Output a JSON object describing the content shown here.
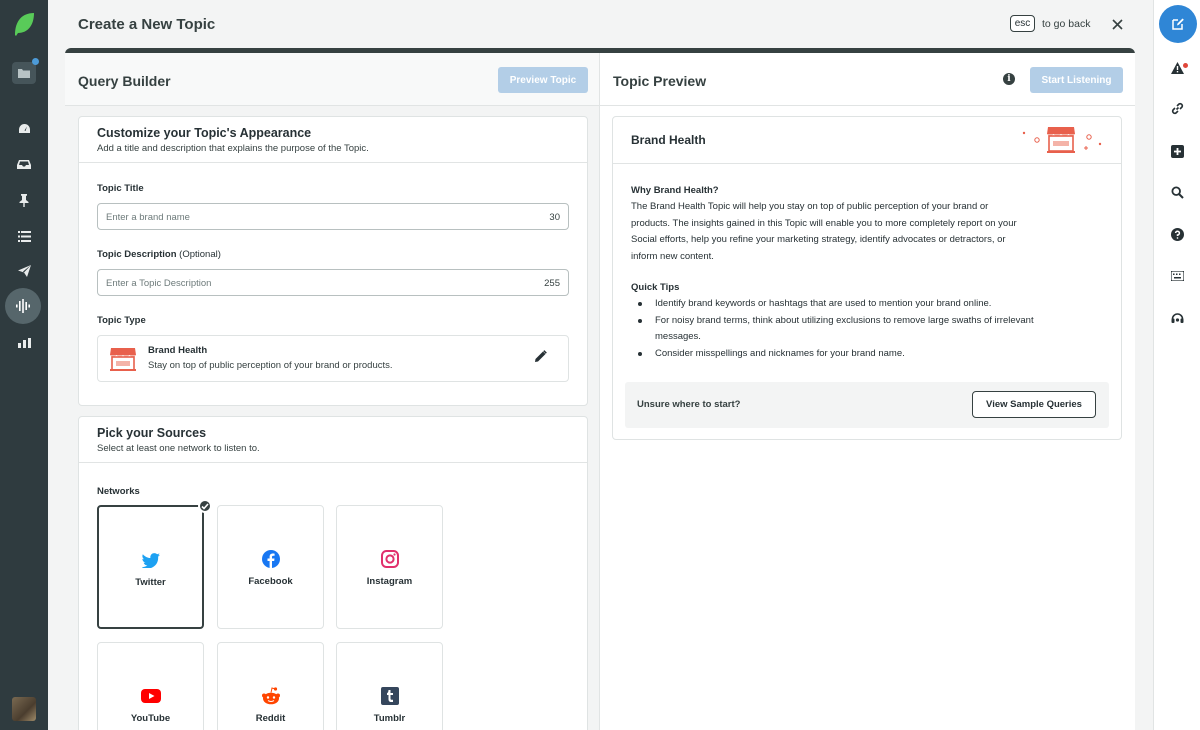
{
  "header": {
    "title": "Create a New Topic",
    "esc_key": "esc",
    "go_back": "to go back"
  },
  "query_builder": {
    "title": "Query Builder",
    "preview_button": "Preview Topic",
    "appearance": {
      "title": "Customize your Topic's Appearance",
      "subtitle": "Add a title and description that explains the purpose of the Topic.",
      "topic_title_label": "Topic Title",
      "topic_title_placeholder": "Enter a brand name",
      "topic_title_count": "30",
      "topic_desc_label": "Topic Description",
      "topic_desc_optional": "(Optional)",
      "topic_desc_placeholder": "Enter a Topic Description",
      "topic_desc_count": "255",
      "topic_type_label": "Topic Type",
      "topic_type_name": "Brand Health",
      "topic_type_desc": "Stay on top of public perception of your brand or products."
    },
    "sources": {
      "title": "Pick your Sources",
      "subtitle": "Select at least one network to listen to.",
      "networks_label": "Networks",
      "networks": [
        {
          "name": "Twitter",
          "icon": "twitter-icon",
          "color": "#1da1f2",
          "selected": true
        },
        {
          "name": "Facebook",
          "icon": "facebook-icon",
          "color": "#1877f2",
          "selected": false
        },
        {
          "name": "Instagram",
          "icon": "instagram-icon",
          "color": "#e1306c",
          "selected": false
        },
        {
          "name": "YouTube",
          "icon": "youtube-icon",
          "color": "#ff0000",
          "selected": false
        },
        {
          "name": "Reddit",
          "icon": "reddit-icon",
          "color": "#ff4500",
          "selected": false
        },
        {
          "name": "Tumblr",
          "icon": "tumblr-icon",
          "color": "#35465c",
          "selected": false
        }
      ]
    }
  },
  "topic_preview": {
    "title": "Topic Preview",
    "start_button": "Start Listening",
    "card_title": "Brand Health",
    "why_heading": "Why Brand Health?",
    "why_lines": [
      "The Brand Health Topic will help you stay on top of public perception of your brand or",
      "products. The insights gained in this Topic will enable you to more completely report on your",
      "Social efforts, help you refine your marketing strategy, identify advocates or detractors, or",
      "inform new content."
    ],
    "tips_heading": "Quick Tips",
    "tips": [
      "Identify brand keywords or hashtags that are used to mention your brand online.",
      "For noisy brand terms, think about utilizing exclusions to remove large swaths of irrelevant messages.",
      "Consider misspellings and nicknames for your brand name."
    ],
    "unsure_text": "Unsure where to start?",
    "sample_button": "View Sample Queries"
  },
  "colors": {
    "accent": "#2f86d6",
    "nav_bg": "#2f3b3f",
    "disabled_button": "#b3cee7",
    "brand_icon": "#e8604c"
  }
}
